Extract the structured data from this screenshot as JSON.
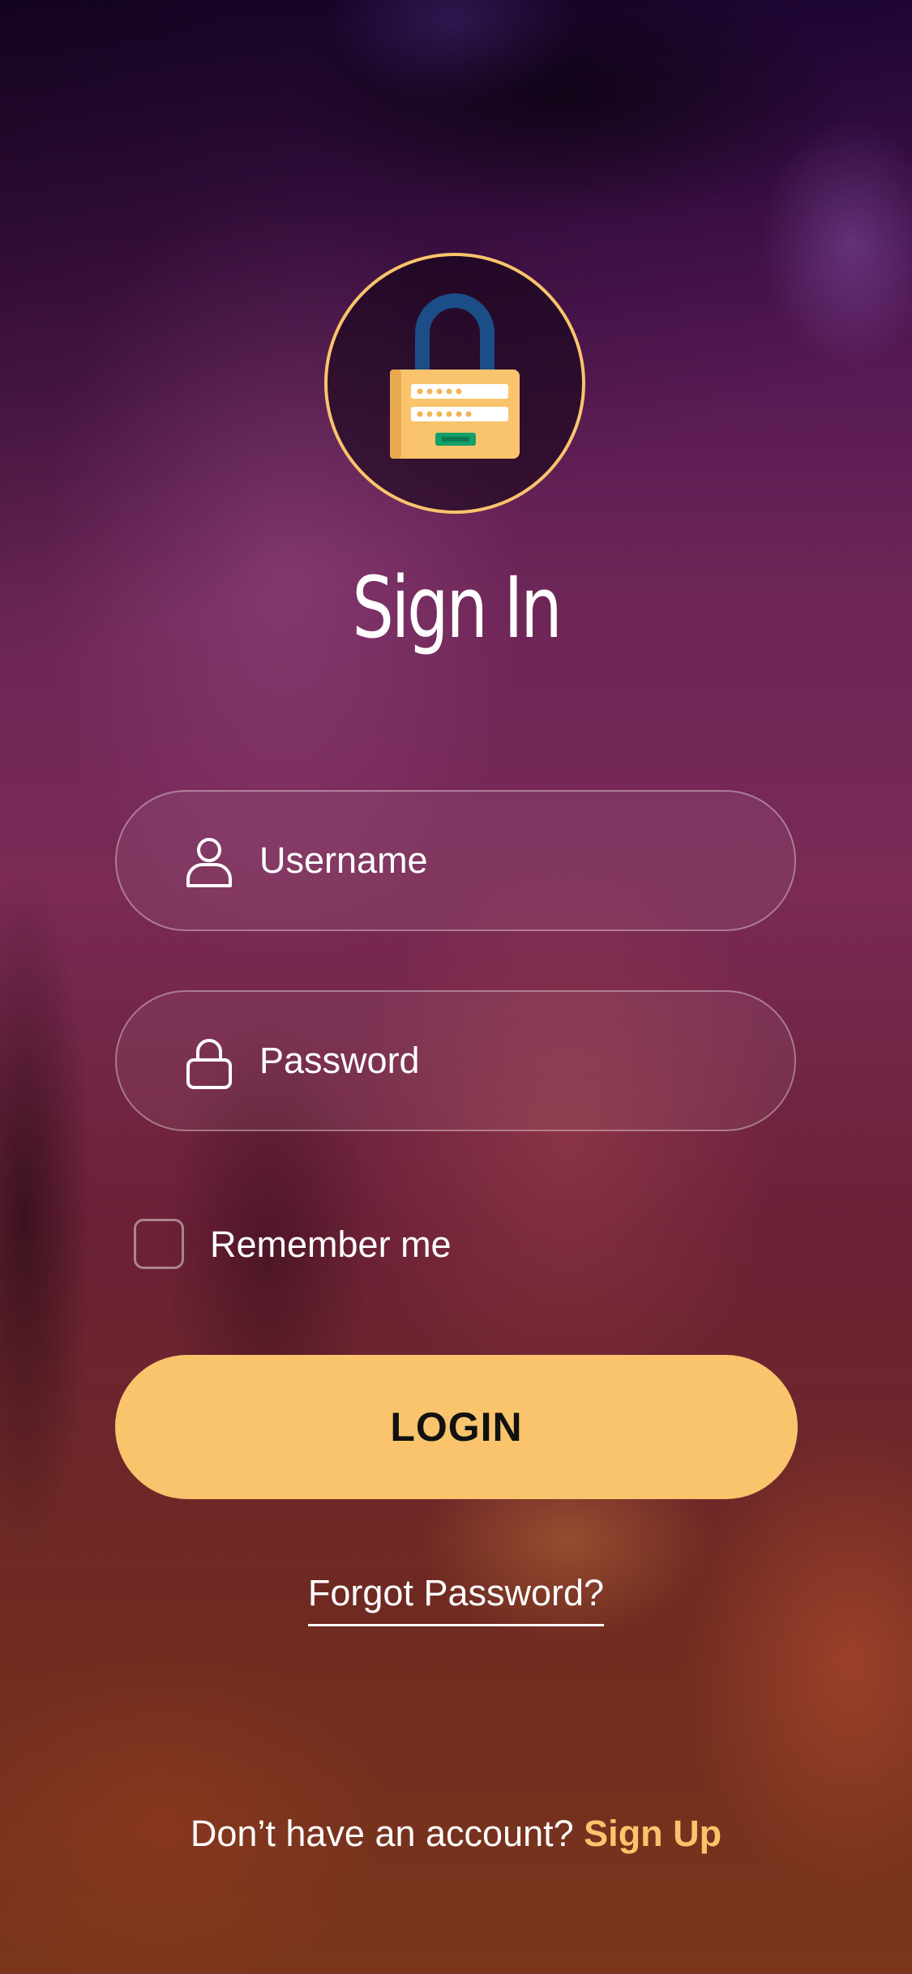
{
  "header": {
    "logo_icon": "padlock-icon",
    "title": "Sign In"
  },
  "form": {
    "username": {
      "icon": "user-icon",
      "placeholder": "Username",
      "value": ""
    },
    "password": {
      "icon": "lock-icon",
      "placeholder": "Password",
      "value": ""
    },
    "remember_label": "Remember me",
    "remember_checked": false,
    "login_label": "LOGIN",
    "forgot_label": "Forgot Password?"
  },
  "footer": {
    "prompt": "Don’t have an account?",
    "signup_label": "Sign Up"
  },
  "colors": {
    "accent": "#f9c46c",
    "text": "#ffffff",
    "button_text": "#111111"
  }
}
